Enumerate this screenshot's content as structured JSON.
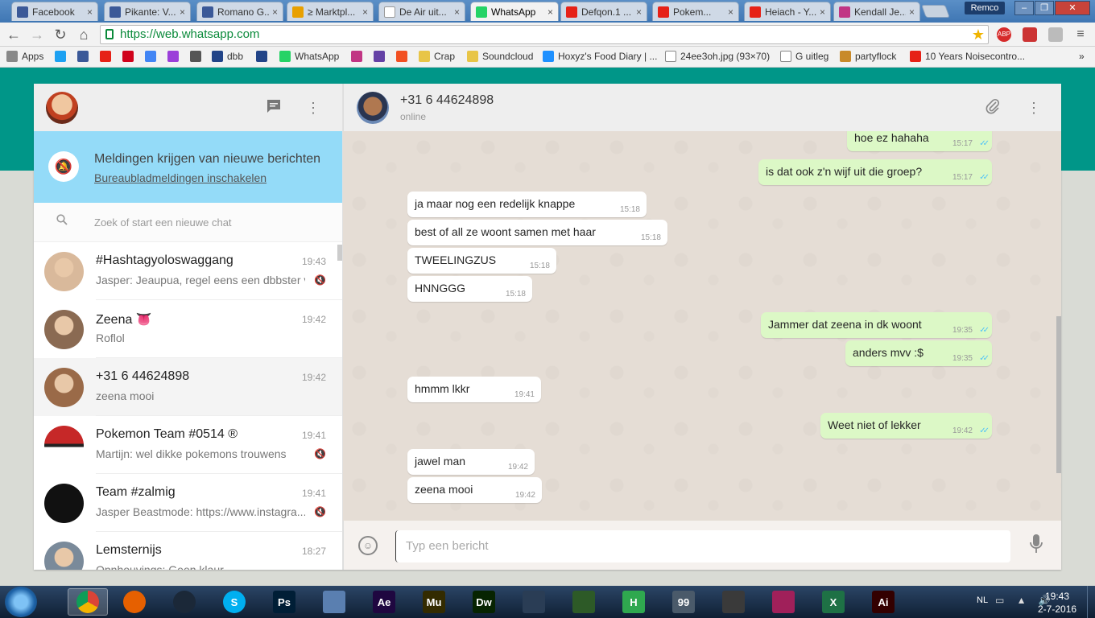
{
  "browser": {
    "tabs": [
      {
        "label": "Facebook",
        "color": "#3b5998",
        "active": false
      },
      {
        "label": "Pikante: V...",
        "color": "#3b5998",
        "active": false
      },
      {
        "label": "Romano G...",
        "color": "#3b5998",
        "active": false
      },
      {
        "label": "≥ Marktpl...",
        "color": "#e8a000",
        "active": false
      },
      {
        "label": "De Air uit...",
        "color": "#ffffff",
        "active": false
      },
      {
        "label": "WhatsApp",
        "color": "#25d366",
        "active": true
      },
      {
        "label": "Defqon.1 ...",
        "color": "#e62117",
        "active": false
      },
      {
        "label": "Pokem...",
        "color": "#e62117",
        "active": false
      },
      {
        "label": "Heiach - Y...",
        "color": "#e62117",
        "active": false
      },
      {
        "label": "Kendall Je...",
        "color": "#c13584",
        "active": false
      }
    ],
    "user_badge": "Remco",
    "url": "https://web.whatsapp.com",
    "bookmarks": [
      {
        "label": "Apps",
        "color": "#888888"
      },
      {
        "label": "",
        "color": "#1da1f2"
      },
      {
        "label": "",
        "color": "#3b5998"
      },
      {
        "label": "",
        "color": "#e62117"
      },
      {
        "label": "",
        "color": "#d0021b"
      },
      {
        "label": "",
        "color": "#4285f4"
      },
      {
        "label": "",
        "color": "#9b3fd9"
      },
      {
        "label": "",
        "color": "#555555"
      },
      {
        "label": "dbb",
        "color": "#224488"
      },
      {
        "label": "",
        "color": "#224488"
      },
      {
        "label": "WhatsApp",
        "color": "#25d366"
      },
      {
        "label": "",
        "color": "#c13584"
      },
      {
        "label": "",
        "color": "#6441a5"
      },
      {
        "label": "",
        "color": "#f25022"
      },
      {
        "label": "Crap",
        "color": "#e8c547"
      },
      {
        "label": "Soundcloud",
        "color": "#e8c547"
      },
      {
        "label": "Hoxyz's Food Diary | ...",
        "color": "#1e90ff"
      },
      {
        "label": "24ee3oh.jpg (93×70)",
        "color": "#ffffff"
      },
      {
        "label": "G uitleg",
        "color": "#ffffff"
      },
      {
        "label": "partyflock",
        "color": "#c88a2a"
      },
      {
        "label": "10 Years Noisecontro...",
        "color": "#e62117"
      }
    ],
    "bookmarks_more": "»"
  },
  "app": {
    "left_header": {
      "new_chat_icon": "chat-icon",
      "menu_icon": "more-vertical-icon"
    },
    "notification": {
      "title": "Meldingen krijgen van nieuwe berichten",
      "link": "Bureaubladmeldingen inschakelen",
      "icon": "bell-off-icon"
    },
    "search": {
      "placeholder": "Zoek of start een nieuwe chat"
    },
    "chats": [
      {
        "name": "#Hashtagyoloswaggang",
        "time": "19:43",
        "preview": "Jasper: Jeaupua, regel eens een dbbster v...",
        "muted": true,
        "active": false,
        "avatar_color": "#d9b99b"
      },
      {
        "name": "Zeena 👅",
        "time": "19:42",
        "preview": "Roflol",
        "muted": false,
        "active": false,
        "avatar_color": "#8a6a52"
      },
      {
        "name": "+31 6 44624898",
        "time": "19:42",
        "preview": "zeena mooi",
        "muted": false,
        "active": true,
        "avatar_color": "#9a6a48"
      },
      {
        "name": "Pokemon Team #0514 ®",
        "time": "19:41",
        "preview": "Martijn: wel dikke pokemons trouwens",
        "muted": true,
        "active": false,
        "avatar_color": "#c62828"
      },
      {
        "name": "Team #zalmig",
        "time": "19:41",
        "preview": "Jasper Beastmode: https://www.instagra...",
        "muted": true,
        "active": false,
        "avatar_color": "#111111"
      },
      {
        "name": "Lemsternijs",
        "time": "18:27",
        "preview": "Opnhouvings: Geen klaur",
        "muted": false,
        "active": false,
        "avatar_color": "#7a8a9a"
      }
    ],
    "conversation": {
      "name": "+31 6 44624898",
      "status": "online",
      "attach_icon": "paperclip-icon",
      "menu_icon": "more-vertical-icon",
      "messages": [
        {
          "dir": "out",
          "text": "hoe ez hahaha",
          "time": "15:17"
        },
        {
          "dir": "out",
          "text": "is dat ook z'n wijf uit die groep?",
          "time": "15:17"
        },
        {
          "dir": "in",
          "text": "ja maar nog een redelijk knappe",
          "time": "15:18"
        },
        {
          "dir": "in",
          "text": "best of all ze woont samen met haar",
          "time": "15:18"
        },
        {
          "dir": "in",
          "text": "TWEELINGZUS",
          "time": "15:18"
        },
        {
          "dir": "in",
          "text": "HNNGGG",
          "time": "15:18"
        },
        {
          "dir": "out",
          "text": "Jammer dat zeena in dk woont",
          "time": "19:35"
        },
        {
          "dir": "out",
          "text": "anders mvv :$",
          "time": "19:35"
        },
        {
          "dir": "in",
          "text": "hmmm lkkr",
          "time": "19:41"
        },
        {
          "dir": "out",
          "text": "Weet niet of lekker",
          "time": "19:42"
        },
        {
          "dir": "in",
          "text": "jawel man",
          "time": "19:42"
        },
        {
          "dir": "in",
          "text": "zeena mooi",
          "time": "19:42"
        }
      ],
      "composer_placeholder": "Typ een bericht",
      "emoji_icon": "emoji-icon",
      "mic_icon": "mic-icon"
    }
  },
  "taskbar": {
    "apps": [
      {
        "name": "chrome",
        "label": "",
        "color": "#4caf50",
        "active": true
      },
      {
        "name": "firefox",
        "label": "",
        "color": "#e66000",
        "active": false
      },
      {
        "name": "steam",
        "label": "",
        "color": "#1b2838",
        "active": false
      },
      {
        "name": "skype",
        "label": "S",
        "color": "#00aff0",
        "active": false
      },
      {
        "name": "photoshop",
        "label": "Ps",
        "color": "#001e36",
        "active": false
      },
      {
        "name": "keyboard",
        "label": "",
        "color": "#5a7fb0",
        "active": false
      },
      {
        "name": "after-effects",
        "label": "Ae",
        "color": "#1f0740",
        "active": false
      },
      {
        "name": "muse",
        "label": "Mu",
        "color": "#332b00",
        "active": false
      },
      {
        "name": "dreamweaver",
        "label": "Dw",
        "color": "#072401",
        "active": false
      },
      {
        "name": "video-editor",
        "label": "",
        "color": "#2a3d55",
        "active": false
      },
      {
        "name": "fl-studio",
        "label": "",
        "color": "#2d5a27",
        "active": false
      },
      {
        "name": "h-app",
        "label": "H",
        "color": "#2fa84f",
        "active": false
      },
      {
        "name": "99-app",
        "label": "99",
        "color": "#4a5a6a",
        "active": false
      },
      {
        "name": "racing-app",
        "label": "",
        "color": "#3a3a3a",
        "active": false
      },
      {
        "name": "game-app",
        "label": "",
        "color": "#a0205a",
        "active": false
      },
      {
        "name": "excel",
        "label": "X",
        "color": "#1e7145",
        "active": false
      },
      {
        "name": "illustrator",
        "label": "Ai",
        "color": "#330000",
        "active": false
      }
    ],
    "language": "NL",
    "time": "19:43",
    "date": "2-7-2016"
  }
}
